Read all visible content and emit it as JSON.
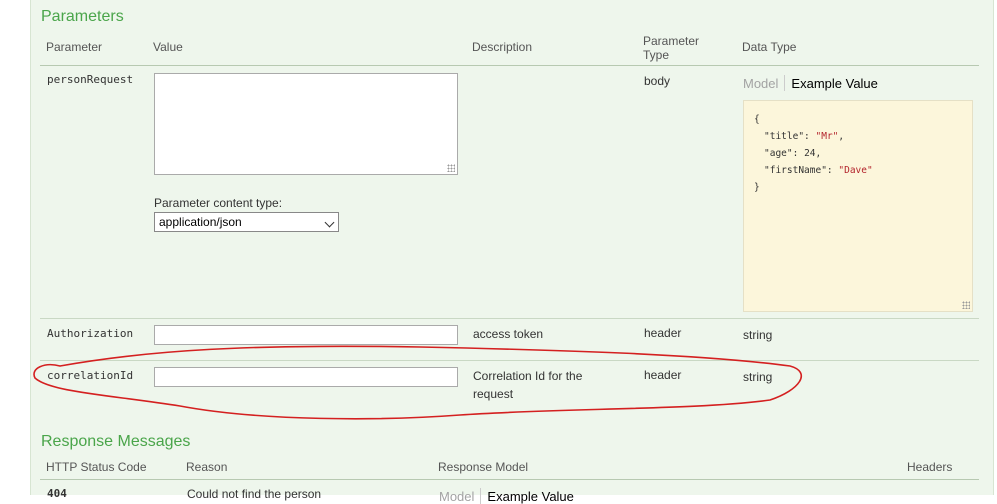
{
  "parameters": {
    "title": "Parameters",
    "headers": {
      "parameter": "Parameter",
      "value": "Value",
      "description": "Description",
      "parameter_type": "Parameter Type",
      "data_type": "Data Type"
    },
    "rows": [
      {
        "name": "personRequest",
        "value": "",
        "content_type_label": "Parameter content type:",
        "content_type_value": "application/json",
        "description": "",
        "param_type": "body",
        "data_type_tabs": [
          "Model",
          "Example Value"
        ],
        "example_lines": [
          {
            "indent": 0,
            "text": "{"
          },
          {
            "indent": 1,
            "key": "\"title\"",
            "sep": ": ",
            "val": "\"Mr\"",
            "kind": "str",
            "end": ","
          },
          {
            "indent": 1,
            "key": "\"age\"",
            "sep": ": ",
            "val": "24",
            "kind": "num",
            "end": ","
          },
          {
            "indent": 1,
            "key": "\"firstName\"",
            "sep": ": ",
            "val": "\"Dave\"",
            "kind": "str",
            "end": ""
          },
          {
            "indent": 0,
            "text": "}"
          }
        ]
      },
      {
        "name": "Authorization",
        "value": "",
        "description": "access token",
        "param_type": "header",
        "data_type": "string"
      },
      {
        "name": "correlationId",
        "value": "",
        "description": "Correlation Id for the request",
        "param_type": "header",
        "data_type": "string"
      }
    ]
  },
  "responses": {
    "title": "Response Messages",
    "headers": {
      "status": "HTTP Status Code",
      "reason": "Reason",
      "model": "Response Model",
      "headers": "Headers"
    },
    "rows": [
      {
        "status": "404",
        "reason": "Could not find the person",
        "tabs": [
          "Model",
          "Example Value"
        ]
      }
    ]
  },
  "annotation": {
    "color": "#d42020"
  }
}
